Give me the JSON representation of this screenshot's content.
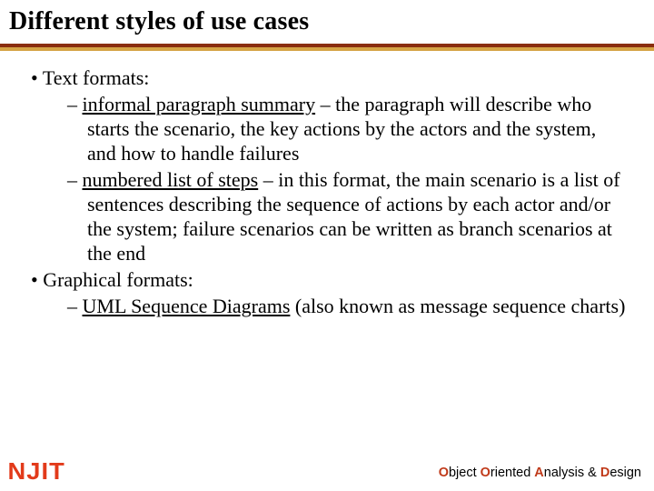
{
  "title": "Different styles of use cases",
  "bullets": {
    "text_formats": "Text formats:",
    "informal_label": "informal paragraph summary",
    "informal_rest": " – the paragraph will describe who starts the scenario, the key actions by the actors and the system, and how to handle failures",
    "numbered_label": "numbered list of steps",
    "numbered_rest": " – in this format, the main scenario is a list of sentences describing the sequence of actions by each actor and/or the system; failure scenarios can be written as branch scenarios at the end",
    "graphical": "Graphical formats:",
    "uml_label": "UML Sequence Diagrams",
    "uml_rest": " (also known as message sequence charts)"
  },
  "footer": {
    "o1": "O",
    "object_rest": "bject ",
    "o2": "O",
    "oriented_rest": "riented ",
    "a": "A",
    "analysis_rest": "nalysis & ",
    "d": "D",
    "design_rest": "esign"
  },
  "logo": {
    "text": "NJIT"
  }
}
